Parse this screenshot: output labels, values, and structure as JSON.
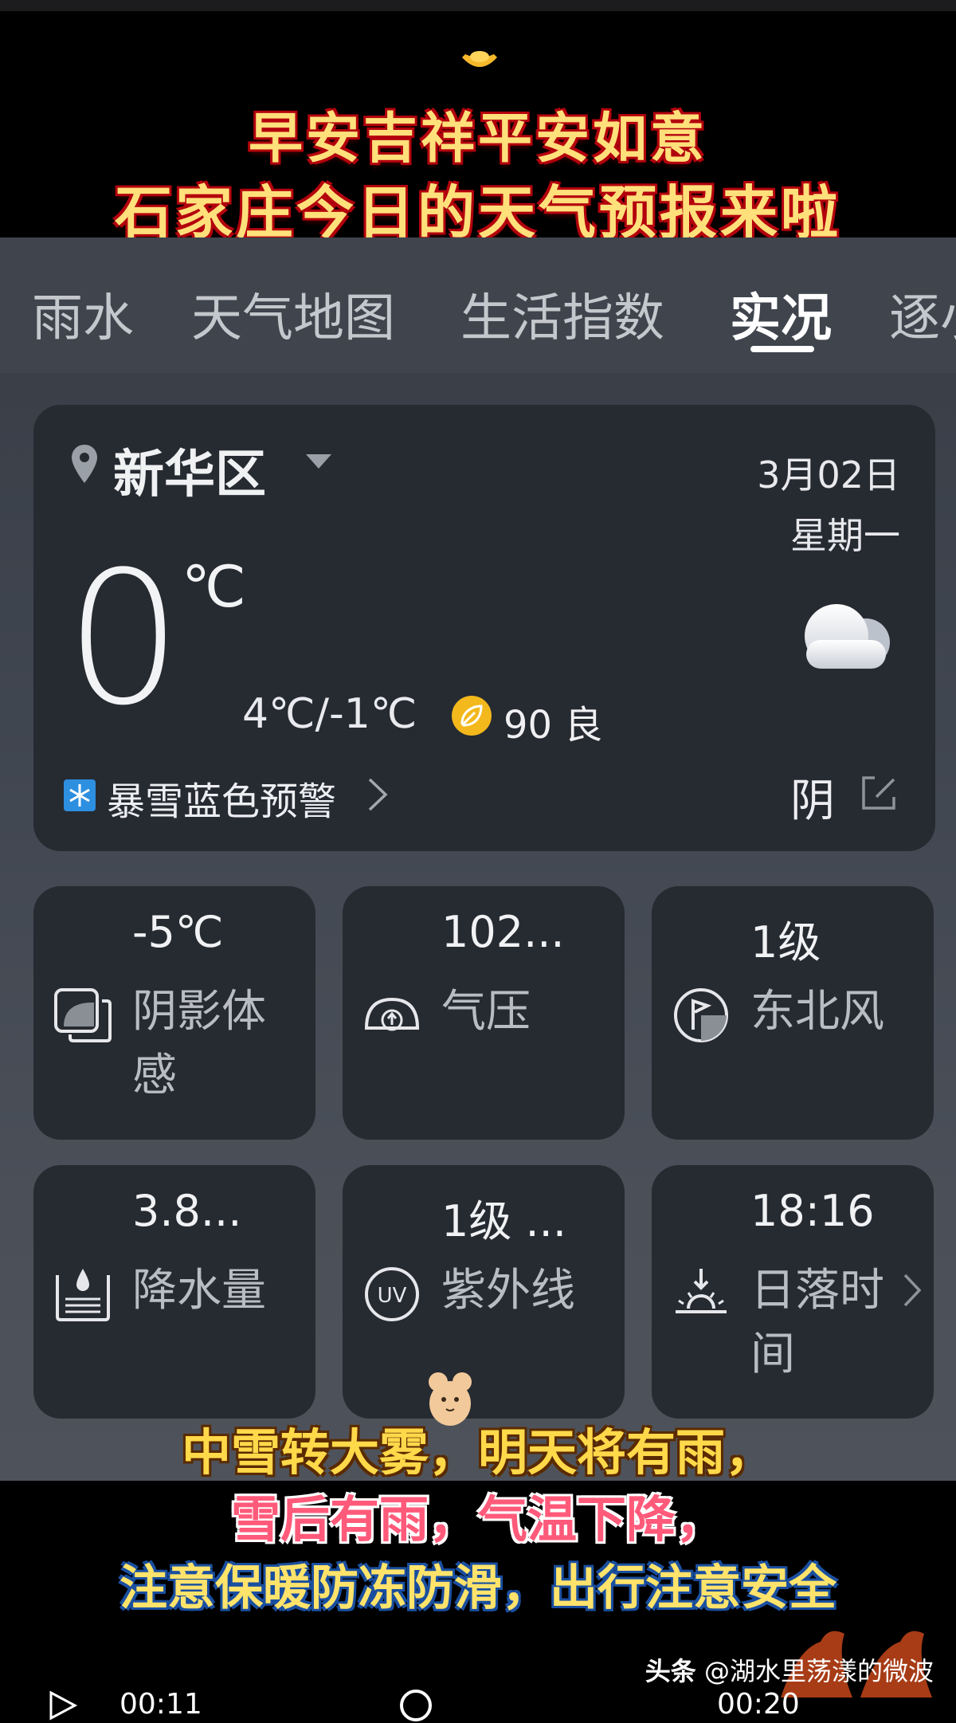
{
  "banner": {
    "line1": "早安吉祥平安如意",
    "line2": "石家庄今日的天气预报来啦"
  },
  "tabs": [
    {
      "label": "雨水",
      "active": false
    },
    {
      "label": "天气地图",
      "active": false
    },
    {
      "label": "生活指数",
      "active": false
    },
    {
      "label": "实况",
      "active": true
    },
    {
      "label": "逐小",
      "active": false
    }
  ],
  "main": {
    "location": "新华区",
    "date": "3月02日",
    "weekday": "星期一",
    "temperature": "0",
    "unit": "℃",
    "range": "4℃/-1℃",
    "aqi": "90 良",
    "alert": "暴雪蓝色预警",
    "condition": "阴"
  },
  "tiles": [
    {
      "value": "-5℃",
      "label": "阴影体感",
      "icon": "feels-like-icon"
    },
    {
      "value": "102...",
      "label": "气压",
      "icon": "pressure-gauge-icon"
    },
    {
      "value": "1级",
      "label": "东北风",
      "icon": "wind-flag-icon"
    },
    {
      "value": "3.8...",
      "label": "降水量",
      "icon": "precipitation-icon"
    },
    {
      "value": "1级 ...",
      "label": "紫外线",
      "icon": "uv-icon"
    },
    {
      "value": "18:16",
      "label": "日落时间",
      "icon": "sunset-icon"
    }
  ],
  "subtitles": {
    "line1": "中雪转大雾，明天将有雨，",
    "line2": "雪后有雨，气温下降，",
    "line3": "注意保暖防冻防滑，出行注意安全"
  },
  "watermark": {
    "brand": "头条",
    "handle": "@湖水里荡漾的微波"
  },
  "player": {
    "time_current": "00:11",
    "time_total": "00:20"
  },
  "colors": {
    "card_bg": "#262a31",
    "aqi_yellow": "#f3b81c",
    "banner_gold": "#ffe07a"
  }
}
